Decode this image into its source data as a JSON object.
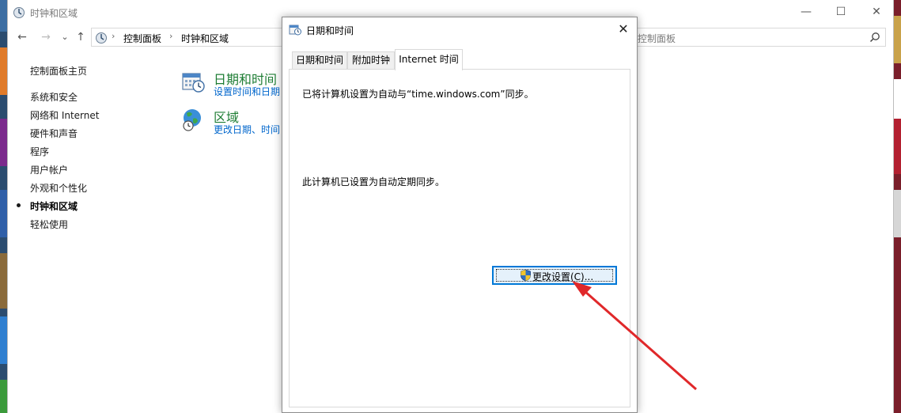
{
  "window": {
    "title": "时钟和区域",
    "controls": {
      "minimize": "—",
      "maximize": "☐",
      "close": "✕"
    }
  },
  "nav": {
    "back": "←",
    "forward": "→",
    "recent": "⌄",
    "up": "↑",
    "breadcrumb": [
      "控制面板",
      "时钟和区域"
    ],
    "separator": "›",
    "search_placeholder": "控制面板"
  },
  "sidebar": {
    "home": "控制面板主页",
    "items": [
      {
        "label": "系统和安全",
        "active": false
      },
      {
        "label": "网络和 Internet",
        "active": false
      },
      {
        "label": "硬件和声音",
        "active": false
      },
      {
        "label": "程序",
        "active": false
      },
      {
        "label": "用户帐户",
        "active": false
      },
      {
        "label": "外观和个性化",
        "active": false
      },
      {
        "label": "时钟和区域",
        "active": true
      },
      {
        "label": "轻松使用",
        "active": false
      }
    ]
  },
  "categories": [
    {
      "title": "日期和时间",
      "subtitle": "设置时间和日期",
      "icon": "calendar-clock-icon"
    },
    {
      "title": "区域",
      "subtitle": "更改日期、时间",
      "icon": "globe-clock-icon"
    }
  ],
  "dialog": {
    "title": "日期和时间",
    "close": "✕",
    "tabs": [
      {
        "label": "日期和时间",
        "active": false
      },
      {
        "label": "附加时钟",
        "active": false
      },
      {
        "label": "Internet 时间",
        "active": true
      }
    ],
    "line1": "已将计算机设置为自动与“time.windows.com”同步。",
    "line2": "此计算机已设置为自动定期同步。",
    "change_button": "更改设置(C)..."
  },
  "colors": {
    "category_title": "#1e7d34",
    "link": "#0066cc",
    "button_border": "#0078d7",
    "annotation_arrow": "#e0282a"
  },
  "annotation": {
    "type": "arrow",
    "target": "change-settings-button"
  }
}
